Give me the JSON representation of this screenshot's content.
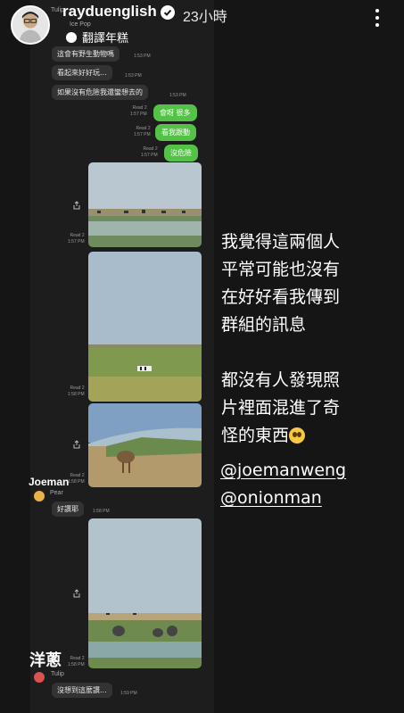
{
  "header": {
    "username": "rayduenglish",
    "time_ago": "23小時"
  },
  "chat": {
    "top_sender": "Tulip",
    "sticker_sender": "Ice Pop",
    "translate_label": "翻譯年糕",
    "incoming": [
      {
        "text": "這會有野生動物嗎",
        "time": "1:53 PM"
      },
      {
        "text": "看起來好好玩...",
        "time": "1:53 PM"
      },
      {
        "text": "如果沒有危險我還蠻想去的",
        "time": "1:53 PM"
      }
    ],
    "outgoing": [
      {
        "text": "會呀 很多",
        "read": "Read 2",
        "time": "1:57 PM"
      },
      {
        "text": "看我跟動",
        "read": "Read 2",
        "time": "1:57 PM"
      },
      {
        "text": "沒危險",
        "read": "Read 2",
        "time": "1:57 PM"
      }
    ],
    "photo_meta": [
      {
        "read": "Read 2",
        "time": "1:57 PM"
      },
      {
        "read": "Read 2",
        "time": "1:58 PM"
      },
      {
        "read": "Read 2",
        "time": "1:58 PM"
      },
      {
        "read": "Read 2",
        "time": "1:58 PM"
      }
    ],
    "reply1": {
      "sender": "Pear",
      "text": "好讚耶",
      "time": "1:58 PM"
    },
    "reply2": {
      "sender": "Tulip",
      "text": "沒想到這麼讚...",
      "time": "1:59 PM"
    }
  },
  "caption": {
    "line1": "我覺得這兩個人",
    "line2": "平常可能也沒有",
    "line3": "在好好看我傳到",
    "line4": "群組的訊息",
    "line5": "都沒有人發現照",
    "line6": "片裡面混進了奇",
    "line7": "怪的東西"
  },
  "mentions": {
    "first": "@joemanweng",
    "second": "@onionman"
  },
  "overlays": {
    "joeman": "Joeman",
    "onion": "洋蔥"
  },
  "colors": {
    "accent_green": "#54c247",
    "background": "#151515"
  }
}
